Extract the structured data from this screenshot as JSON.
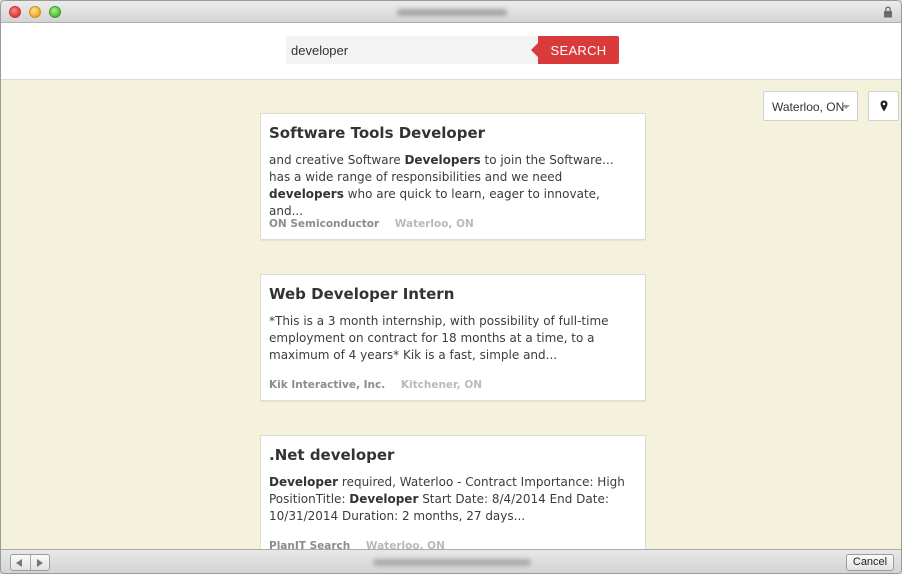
{
  "window": {
    "icons": {
      "close": "close-dot",
      "minimize": "minimize-dot",
      "zoom": "zoom-dot",
      "lock": "lock-icon"
    }
  },
  "search": {
    "query": "developer",
    "button_label": "SEARCH"
  },
  "location": {
    "selected": "Waterloo, ON",
    "locate_icon": "map-pin-icon"
  },
  "colors": {
    "accent": "#d93a3a",
    "background": "#f4f2dc",
    "card": "#ffffff"
  },
  "results": [
    {
      "title": "Software Tools Developer",
      "snippet": [
        {
          "t": "and creative Software "
        },
        {
          "t": "Developers",
          "b": true
        },
        {
          "t": " to join the Software... has a wide range of responsibilities and we need "
        },
        {
          "t": "developers",
          "b": true
        },
        {
          "t": " who are quick to learn, eager to innovate, and..."
        }
      ],
      "company": "ON Semiconductor",
      "location": "Waterloo, ON"
    },
    {
      "title": "Web Developer Intern",
      "snippet": [
        {
          "t": "*This is a 3 month internship, with possibility of full-time employment on contract for 18 months at a time, to a maximum of 4 years* Kik is a fast, simple and..."
        }
      ],
      "company": "Kik Interactive, Inc.",
      "location": "Kitchener, ON"
    },
    {
      "title": ".Net developer",
      "snippet": [
        {
          "t": "Developer",
          "b": true
        },
        {
          "t": " required, Waterloo - Contract Importance: High PositionTitle: "
        },
        {
          "t": "Developer",
          "b": true
        },
        {
          "t": " Start Date: 8/4/2014 End Date: 10/31/2014 Duration: 2 months, 27 days..."
        }
      ],
      "company": "PlanIT Search",
      "location": "Waterloo, ON"
    }
  ],
  "bottom_bar": {
    "cancel_label": "Cancel",
    "back_icon": "back-arrow-icon",
    "forward_icon": "forward-arrow-icon"
  }
}
